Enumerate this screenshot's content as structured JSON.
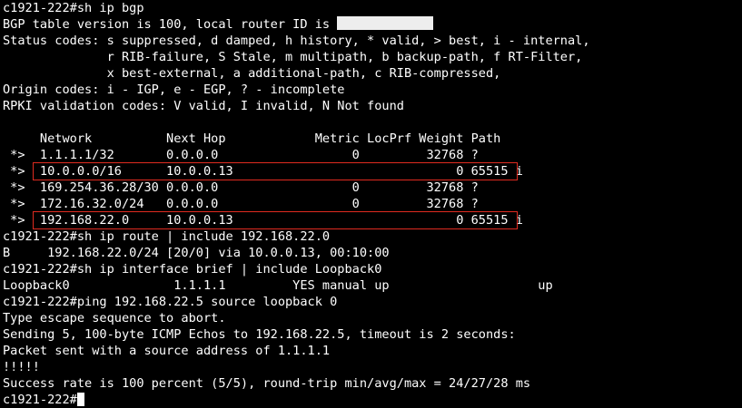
{
  "terminal": {
    "lines": [
      "c1921-222#sh ip bgp",
      "BGP table version is 100, local router ID is ",
      "Status codes: s suppressed, d damped, h history, * valid, > best, i - internal,",
      "              r RIB-failure, S Stale, m multipath, b backup-path, f RT-Filter,",
      "              x best-external, a additional-path, c RIB-compressed,",
      "Origin codes: i - IGP, e - EGP, ? - incomplete",
      "RPKI validation codes: V valid, I invalid, N Not found",
      "",
      "     Network          Next Hop            Metric LocPrf Weight Path",
      " *>  1.1.1.1/32       0.0.0.0                  0         32768 ?",
      " *>  10.0.0.0/16      10.0.0.13                              0 65515 i",
      " *>  169.254.36.28/30 0.0.0.0                  0         32768 ?",
      " *>  172.16.32.0/24   0.0.0.0                  0         32768 ?",
      " *>  192.168.22.0     10.0.0.13                              0 65515 i",
      "c1921-222#sh ip route | include 192.168.22.0",
      "B     192.168.22.0/24 [20/0] via 10.0.0.13, 00:10:00",
      "c1921-222#sh ip interface brief | include Loopback0",
      "Loopback0              1.1.1.1         YES manual up                    up",
      "c1921-222#ping 192.168.22.5 source loopback 0",
      "Type escape sequence to abort.",
      "Sending 5, 100-byte ICMP Echos to 192.168.22.5, timeout is 2 seconds:",
      "Packet sent with a source address of 1.1.1.1",
      "!!!!!",
      "Success rate is 100 percent (5/5), round-trip min/avg/max = 24/27/28 ms",
      "c1921-222#"
    ]
  },
  "colors": {
    "background": "#000000",
    "text": "#ffffff",
    "highlight_border": "#e02b20",
    "redaction": "#ededed"
  }
}
